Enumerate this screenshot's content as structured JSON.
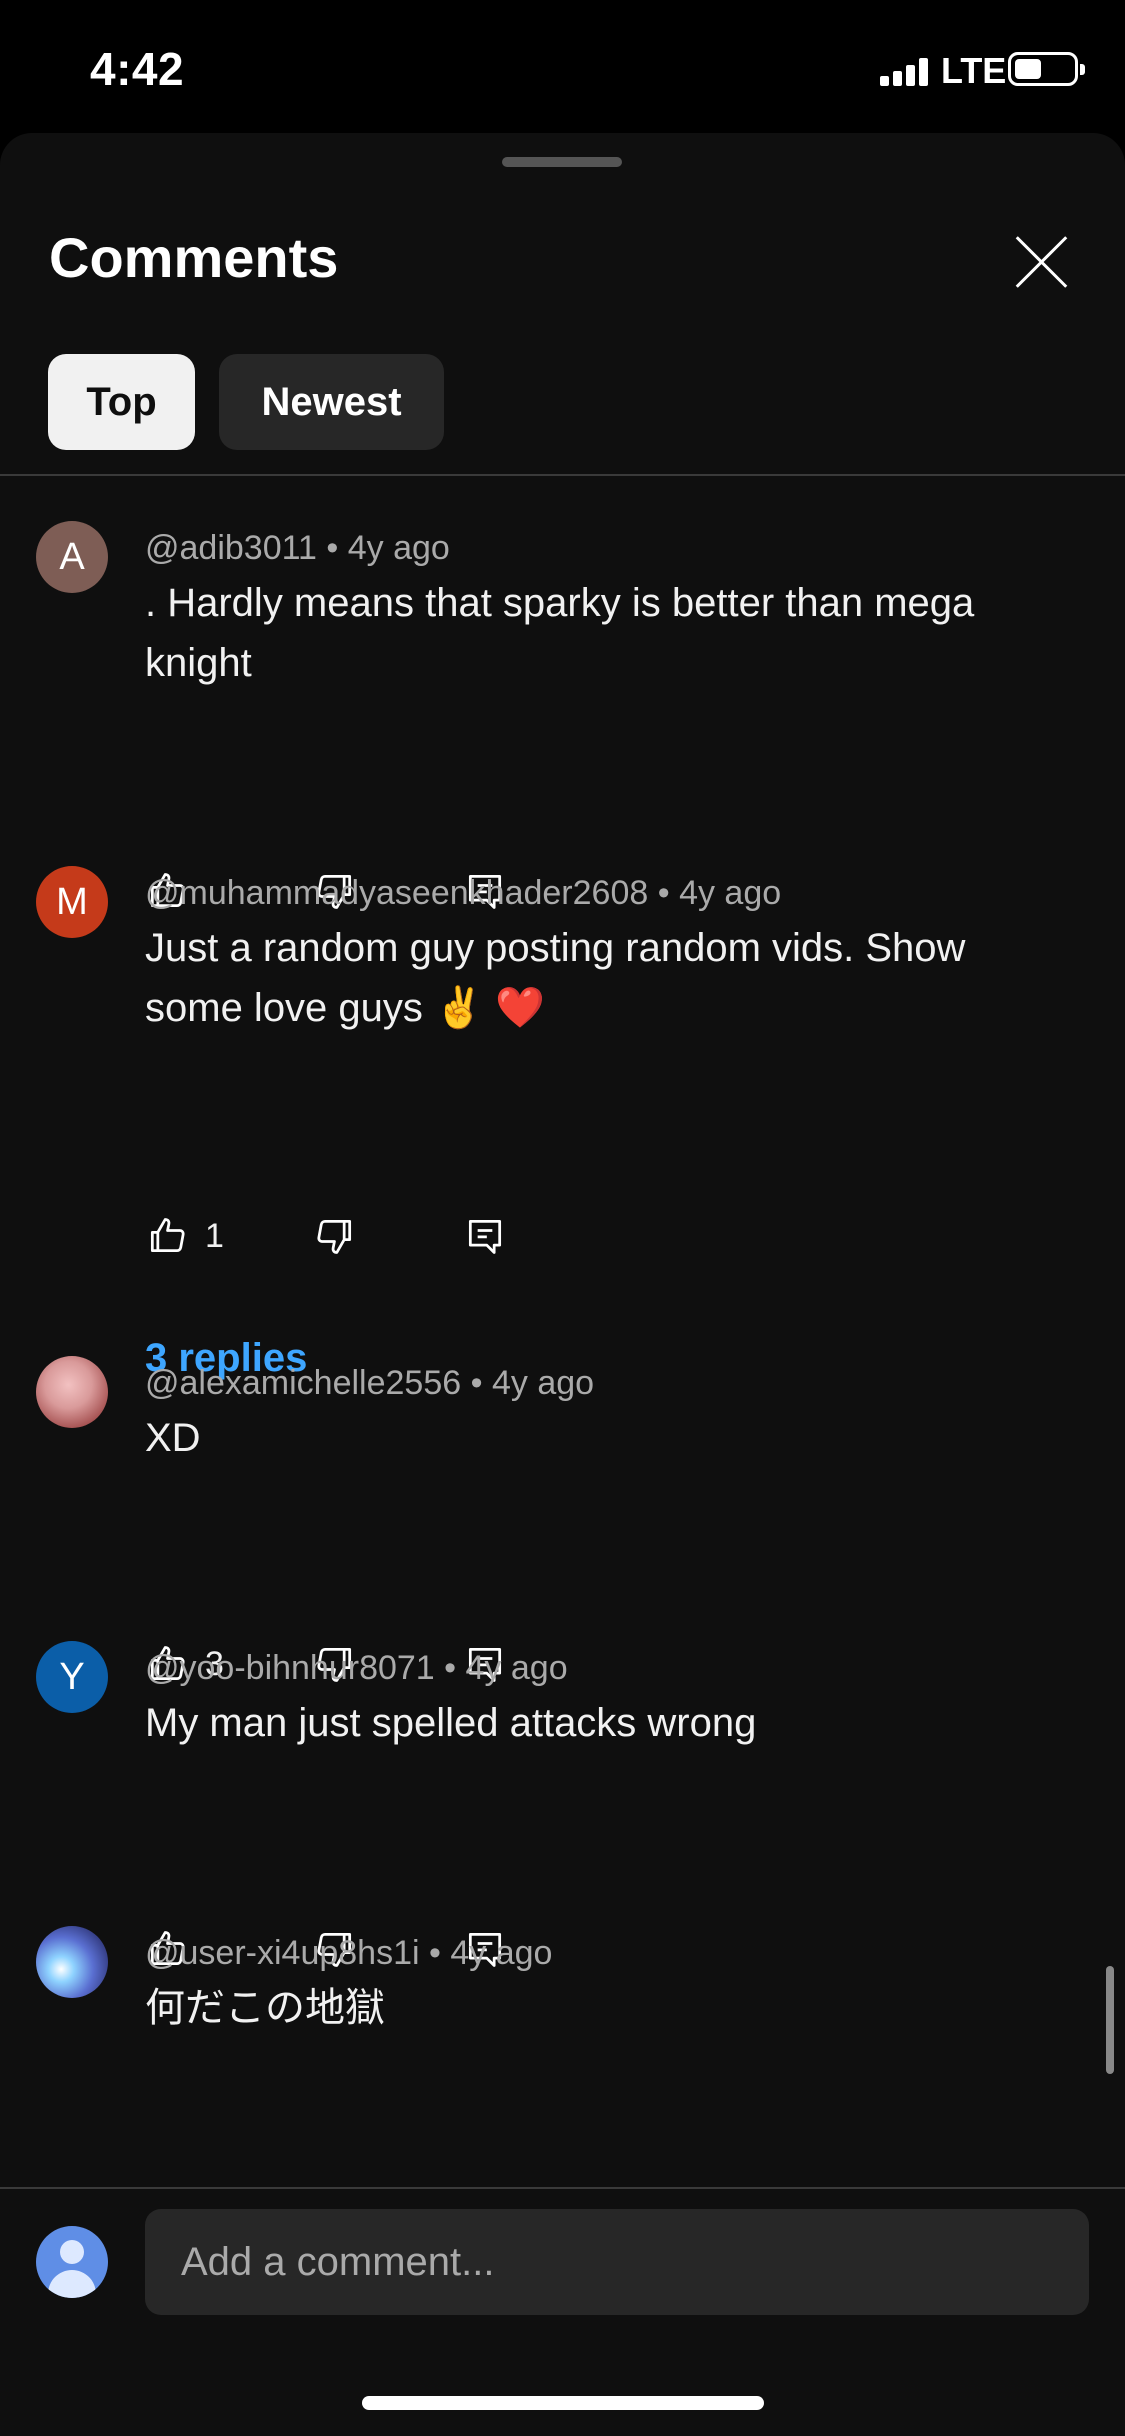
{
  "status_bar": {
    "time": "4:42",
    "network": "LTE"
  },
  "sheet": {
    "title": "Comments"
  },
  "sort_chips": [
    {
      "label": "Top"
    },
    {
      "label": "Newest"
    }
  ],
  "comments": [
    {
      "avatar_letter": "A",
      "avatar_color": "#7e5d55",
      "author": "@adib3011",
      "time": "4y ago",
      "text": ". Hardly means that sparky is better than mega knight",
      "likes": ""
    },
    {
      "avatar_letter": "M",
      "avatar_color": "#c53a1a",
      "author": "@muhammadyaseenkhader2608",
      "time": "4y ago",
      "text": "Just a random guy posting random vids. Show some love guys ✌️ ❤️",
      "likes": "1",
      "replies_label": "3 replies"
    },
    {
      "avatar_letter": "",
      "avatar_color": "#c98e8e",
      "author": "@alexamichelle2556",
      "time": "4y ago",
      "text": "XD",
      "likes": "3"
    },
    {
      "avatar_letter": "Y",
      "avatar_color": "#0b5ea8",
      "author": "@yoo-bihnhur8071",
      "time": "4y ago",
      "text": "My man just spelled attacks wrong",
      "likes": ""
    },
    {
      "avatar_letter": "",
      "avatar_color": "#6a7fb8",
      "author": "@user-xi4up8hs1i",
      "time": "4y ago",
      "text": "何だこの地獄",
      "likes": "1"
    }
  ],
  "composer": {
    "placeholder": "Add a comment..."
  },
  "colors": {
    "background": "#0f0f0f",
    "link_blue": "#3ea6ff",
    "chip_selected": "#f1f1f1"
  }
}
